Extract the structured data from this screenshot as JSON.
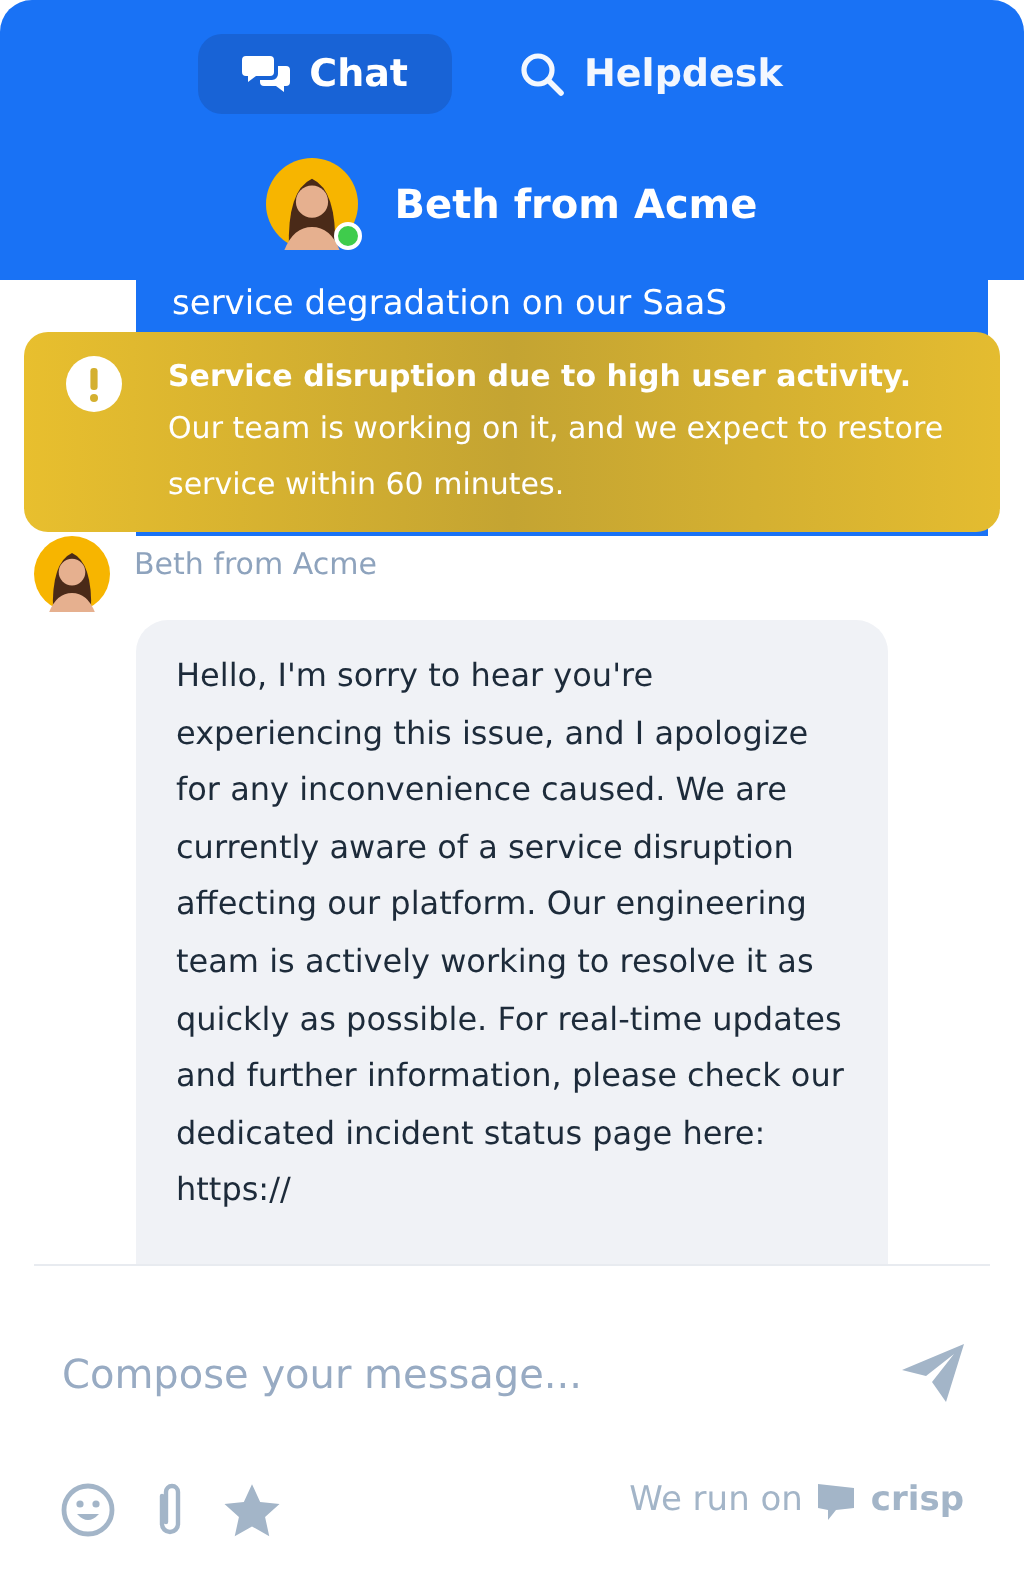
{
  "tabs": [
    {
      "label": "Chat",
      "kind": "chat",
      "selected": true
    },
    {
      "label": "Helpdesk",
      "kind": "search",
      "selected": false
    }
  ],
  "header": {
    "name": "Beth from Acme",
    "online": true
  },
  "messages": [
    {
      "kind": "user",
      "text": "service degradation on our SaaS"
    },
    {
      "kind": "operator",
      "author": "Beth from Acme",
      "text": "Hello, I'm sorry to hear you're experiencing this issue, and I apologize for any inconvenience caused. We are currently aware of a service disruption affecting our platform. Our engineering team is actively working to resolve it as quickly as possible. For real-time updates and further information, please check our dedicated incident status page here: https://"
    }
  ],
  "alert": {
    "title": "Service disruption due to high user activity.",
    "body": "Our team is working on it, and we expect to restore service within 60 minutes."
  },
  "composer": {
    "placeholder": "Compose your message..."
  },
  "footer": {
    "tools": [
      {
        "kind": "emoji"
      },
      {
        "kind": "attach"
      },
      {
        "kind": "star"
      }
    ],
    "branding": "We run on",
    "brand": "crisp"
  }
}
